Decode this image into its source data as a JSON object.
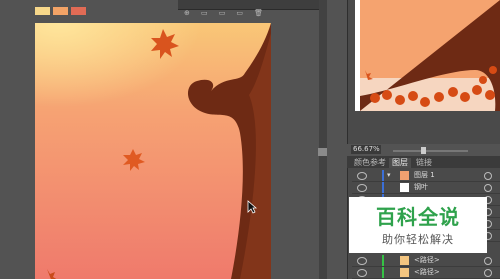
{
  "colors": {
    "ui_bg": "#535353",
    "panel_bg": "#4a4a4a",
    "tab_bar": "#3b3b3b",
    "accent_green": "#2fa24c"
  },
  "swatches": [
    "#f6d78a",
    "#f3a366",
    "#e16b55"
  ],
  "tool_icons": [
    "new-layer-icon",
    "page-icon",
    "page-icon",
    "page-icon",
    "trash-icon"
  ],
  "navigator": {
    "zoom": "66.67%"
  },
  "panel_tabs": [
    {
      "label": "颜色参考",
      "active": false
    },
    {
      "label": "图层",
      "active": true
    },
    {
      "label": "链接",
      "active": false
    }
  ],
  "layers": [
    {
      "label": "图层 1",
      "color": "#3b6fd8",
      "expanded": true
    },
    {
      "label": "钢叶",
      "color": "#3b6fd8"
    },
    {
      "label": "",
      "color": "#3b6fd8"
    },
    {
      "label": "",
      "color": "#3b6fd8"
    },
    {
      "label": "",
      "color": "#3b6fd8"
    },
    {
      "label": "",
      "color": "#3b6fd8"
    },
    {
      "label": "<路径>",
      "color": "#35c245"
    },
    {
      "label": "<路径>",
      "color": "#35c245"
    }
  ],
  "watermark": {
    "title": "百科全说",
    "subtitle": "助你轻松解决"
  }
}
